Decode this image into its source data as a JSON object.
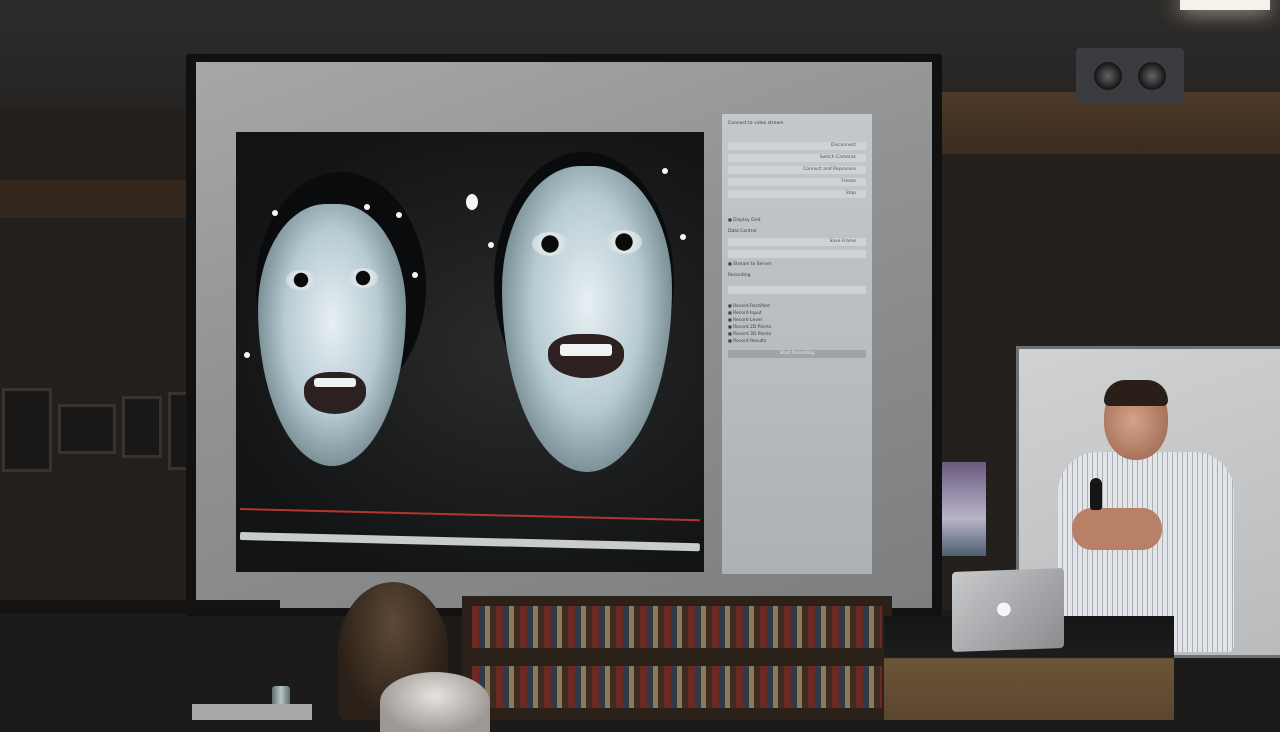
{
  "scene": {
    "description_tags": [
      "presentation-room",
      "projector-screen",
      "speaker",
      "audience"
    ]
  },
  "projection": {
    "panel": {
      "heading": "Connect to video stream",
      "rows": [
        {
          "type": "bar",
          "label": "Disconnect"
        },
        {
          "type": "bar",
          "label": "Switch Cameras"
        },
        {
          "type": "bar",
          "label": "Connect and Reprocess"
        },
        {
          "type": "bar",
          "label": "Freeze"
        },
        {
          "type": "bar",
          "label": "Stop"
        }
      ],
      "display_grid": "Display Grid",
      "data_control": "Data Control",
      "save_button": "Save Frame",
      "stream_to_server": "Stream to Server",
      "recording": "Recording",
      "checkboxes": [
        "Record Rectified",
        "Record Input",
        "Record Level",
        "Record 2D Points",
        "Record 3D Points",
        "Record Results"
      ],
      "start_button": "Start Recording"
    }
  },
  "colors": {
    "screen": "#9a9c9e",
    "panel": "#c0c3c5",
    "red_line": "#b5352d",
    "wood": "#4e3a28"
  },
  "icons": [
    "apple-logo-icon",
    "speaker-icon",
    "microphone-icon"
  ]
}
